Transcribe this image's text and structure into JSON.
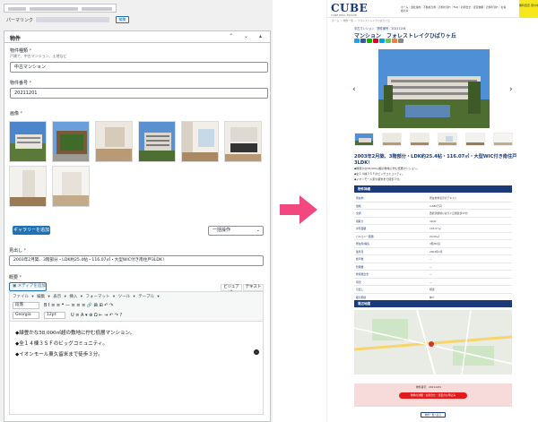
{
  "editor": {
    "permalink_label": "パーマリンク",
    "permalink_edit": "編集",
    "metabox_title": "物件",
    "metabox_controls": "⌃ ⌄ ▴",
    "property_type": {
      "label": "物件種類",
      "required": "*",
      "description": "戸建て、中古マンション、土地など",
      "value": "中古マンション"
    },
    "property_number": {
      "label": "物件番号",
      "required": "*",
      "value": "20211201"
    },
    "images": {
      "label": "画像",
      "required": "*"
    },
    "add_to_gallery": "ギャラリーを追加",
    "bulk_actions": "一括操作",
    "heading": {
      "label": "見出し",
      "required": "*",
      "value": "2003年2月築、3階部分・LDK約25.4帖・116.07㎡・大型WIC付き南住戸3LDK！"
    },
    "overview": {
      "label": "概要",
      "required": "*"
    },
    "add_media": "メディアを追加",
    "tab_visual": "ビジュアル",
    "tab_text": "テキスト",
    "menubar": "ファイル ▾  編集 ▾  表示 ▾  挿入 ▾  フォーマット ▾  ツール ▾  テーブル ▾",
    "format_select": "段落",
    "font_select": "Georgia",
    "size_select": "12pt",
    "toolbar_row1": "B  I  ≡  ≡  ❝  —  ≡  ≡  ≡  🔗  ⊠  ⊞  ↶  ↷",
    "toolbar_row2": "U  ≡  A  ▾  ⊕  Ω  ⇤  ⇥  ↶  ↷  ?",
    "content_lines": [
      "◆緑豊かな58,000㎡超の敷地に佇む低層マンション。",
      "◆全１４棟３ＳＦのビッグコミュニティ。",
      "◆イオンモール東久留米まで徒歩３分。"
    ]
  },
  "preview": {
    "logo": "CUBE",
    "logo_sub": "CUBE REAL ESTATE",
    "nav_text": "ホーム｜会社案内｜不動産売却｜売却の流れ｜FAQ｜お問合せ｜査定依頼｜売却の流れ｜お客様の声",
    "yellow_box": "無料査定 受付中",
    "breadcrumb": "ホーム ＞ 物件一覧 ＞ フォレストレイクひばりヶ丘",
    "tag": "中古マンション　物件番号：20211201",
    "title": "マンション　フォレストレイクひばりヶ丘",
    "catch": "2003年2月築、3階部分・LDK約25.4帖・116.07㎡・大型WIC付き南住戸3LDK！",
    "bullets": [
      "◆緑豊かな58,000㎡超の敷地に佇む低層マンション。",
      "◆全１４棟３ＳＦのビッグコミュニティ。",
      "◆イオンモール東久留米まで徒歩３分。"
    ],
    "section_details": "物件詳細",
    "table": [
      {
        "k": "所在地",
        "v": "所在地非表示のテキスト"
      },
      {
        "k": "価格",
        "v": "4,680万円"
      },
      {
        "k": "交通",
        "v": "西武池袋線ひばりヶ丘駅徒歩15分"
      },
      {
        "k": "間取り",
        "v": "3LDK"
      },
      {
        "k": "専有面積",
        "v": "116.07㎡"
      },
      {
        "k": "バルコニー面積",
        "v": "20.00㎡"
      },
      {
        "k": "所在階/構造",
        "v": "3階/RC造"
      },
      {
        "k": "築年月",
        "v": "2003年2月"
      },
      {
        "k": "総戸数",
        "v": "—"
      },
      {
        "k": "管理費",
        "v": "—"
      },
      {
        "k": "修繕積立金",
        "v": "—"
      },
      {
        "k": "現況",
        "v": "—"
      },
      {
        "k": "引渡し",
        "v": "相談"
      },
      {
        "k": "取引態様",
        "v": "仲介"
      }
    ],
    "section_map": "周辺地図",
    "cta_label": "物件番号：20211201",
    "cta_button": "物件の詳細・お問合せ・査定のお申込み",
    "back_button": "物件一覧へ戻る"
  },
  "colors": {
    "wp_blue": "#2271b1",
    "brand_navy": "#1b3a7a",
    "arrow_pink": "#f2477f",
    "cta_red": "#e21c1c"
  }
}
